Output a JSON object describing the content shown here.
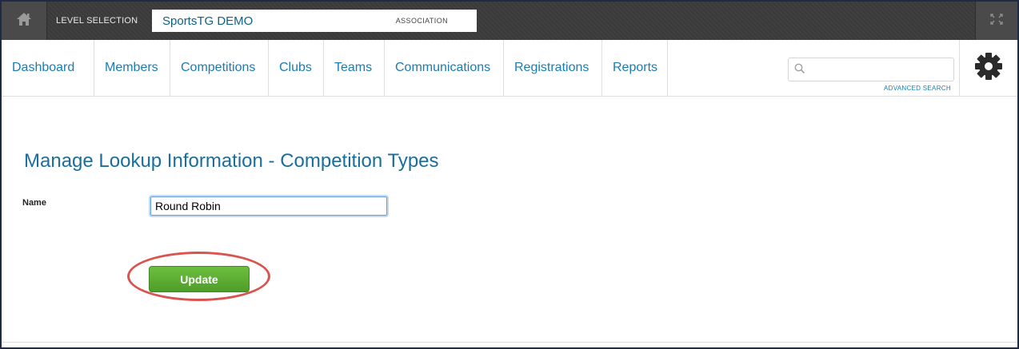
{
  "topbar": {
    "home_icon": "home-icon",
    "level_selection_label": "LEVEL SELECTION",
    "association_name": "SportsTG DEMO",
    "association_type": "ASSOCIATION",
    "expand_icon": "expand-icon"
  },
  "nav": {
    "items": [
      {
        "label": "Dashboard"
      },
      {
        "label": "Members"
      },
      {
        "label": "Competitions"
      },
      {
        "label": "Clubs"
      },
      {
        "label": "Teams"
      },
      {
        "label": "Communications"
      },
      {
        "label": "Registrations"
      },
      {
        "label": "Reports"
      }
    ],
    "search_placeholder": "",
    "search_icon": "search-icon",
    "advanced_search_label": "ADVANCED SEARCH",
    "settings_icon": "gear-icon"
  },
  "main": {
    "title": "Manage Lookup Information - Competition Types",
    "name_label": "Name",
    "name_value": "Round Robin",
    "update_label": "Update"
  },
  "colors": {
    "link_blue": "#1a7cb2",
    "title_blue": "#1a6e9e",
    "update_green": "#5aad32",
    "highlight_red": "#d9534f",
    "topbar_dark": "#3b3b3b"
  }
}
